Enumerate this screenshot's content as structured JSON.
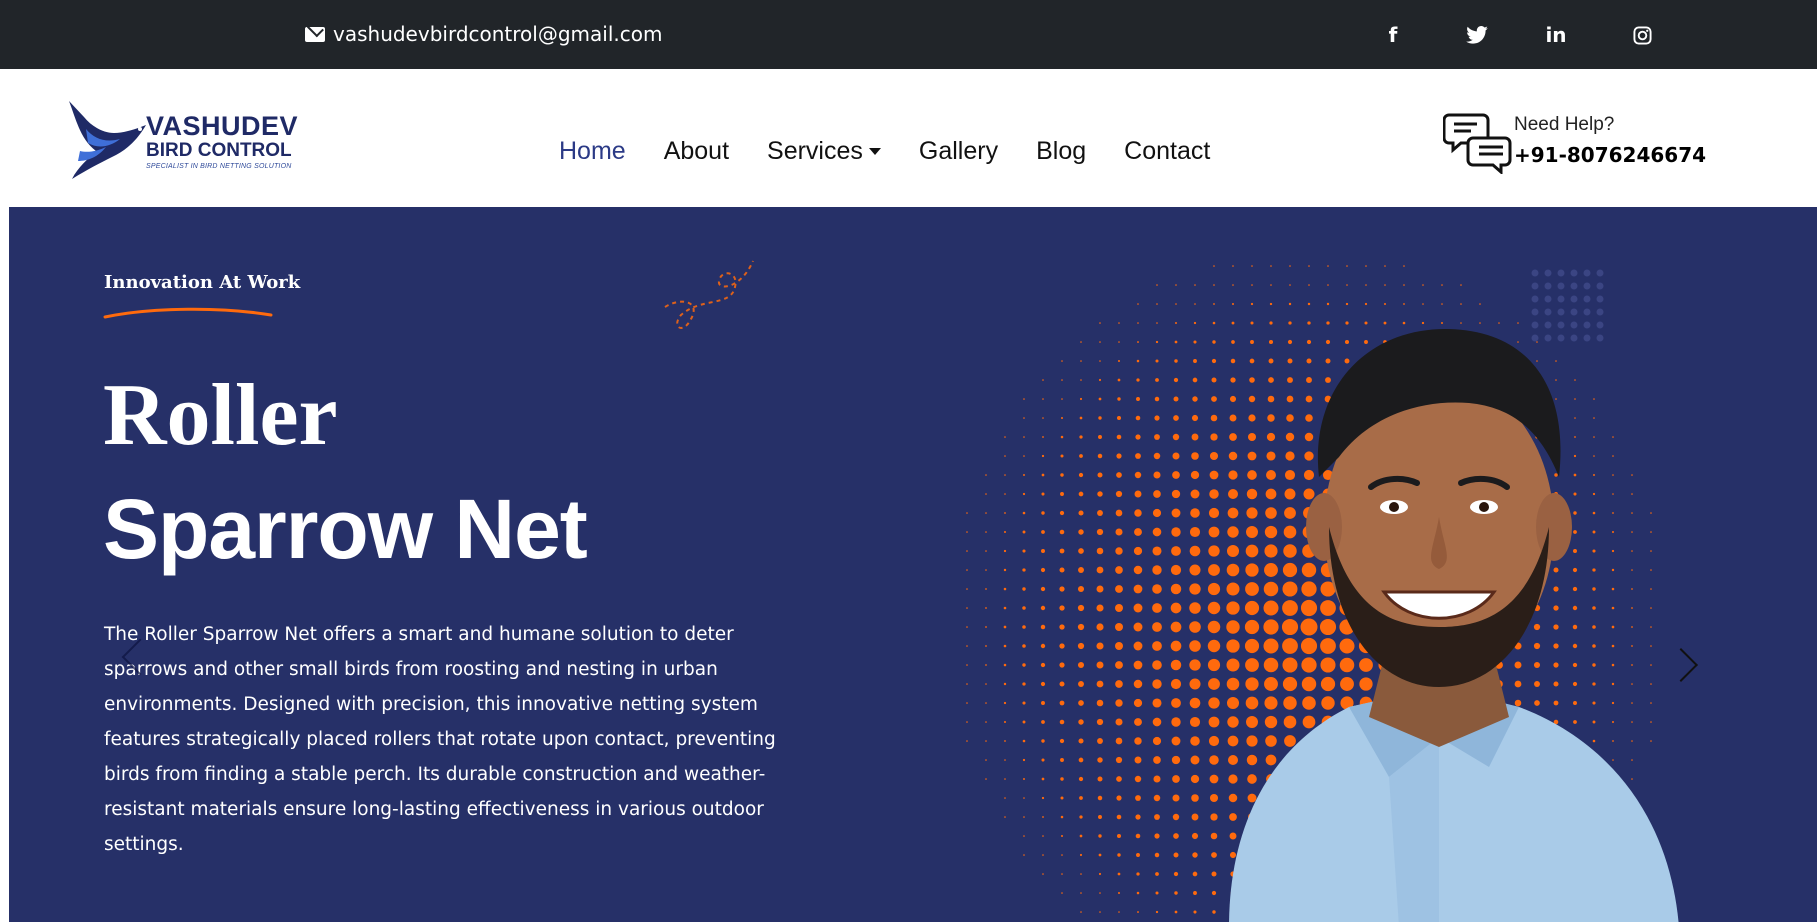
{
  "topbar": {
    "email": "vashudevbirdcontrol@gmail.com",
    "social": [
      {
        "icon": "facebook-icon",
        "glyph": "f"
      },
      {
        "icon": "twitter-icon",
        "glyph": "🐦"
      },
      {
        "icon": "linkedin-icon",
        "glyph": "in"
      },
      {
        "icon": "instagram-icon",
        "glyph": "◎"
      }
    ]
  },
  "header": {
    "logo": {
      "line1": "VASHUDEV",
      "line2": "BIRD CONTROL",
      "tagline": "SPECIALIST IN BIRD NETTING SOLUTION"
    },
    "nav": [
      {
        "label": "Home",
        "active": true
      },
      {
        "label": "About"
      },
      {
        "label": "Services",
        "dropdown": true
      },
      {
        "label": "Gallery"
      },
      {
        "label": "Blog"
      },
      {
        "label": "Contact"
      }
    ],
    "help": {
      "label": "Need Help?",
      "phone": "+91-8076246674"
    }
  },
  "hero": {
    "eyebrow": "Innovation At Work",
    "title_line1": "Roller",
    "title_line2": "Sparrow Net",
    "description": "The Roller Sparrow Net offers a smart and humane solution to deter sparrows and other small birds from roosting and nesting in urban environments. Designed with precision, this innovative netting system features strategically placed rollers that rotate upon contact, preventing birds from finding a stable perch. Its durable construction and weather-resistant materials ensure long-lasting effectiveness in various outdoor settings."
  },
  "colors": {
    "topbar_bg": "#212529",
    "hero_bg": "#263068",
    "accent_orange": "#ff6a0d",
    "brand_navy": "#1f2a66",
    "nav_active": "#2b3a86"
  }
}
